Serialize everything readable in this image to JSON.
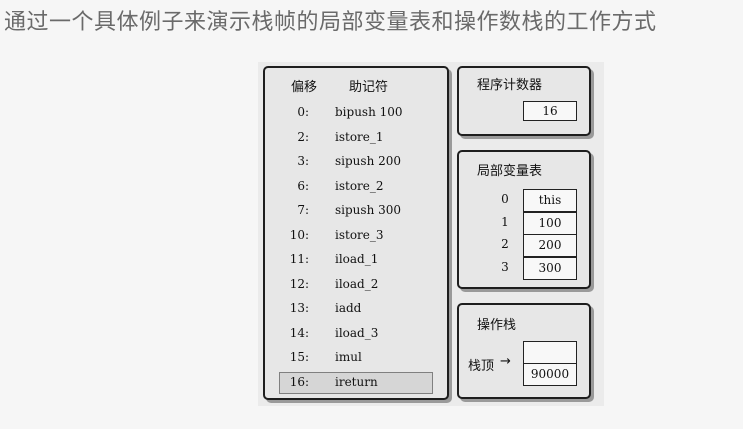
{
  "heading": "通过一个具体例子来演示栈帧的局部变量表和操作数栈的工作方式",
  "code_table": {
    "header_offset": "偏移",
    "header_mnemonic": "助记符",
    "rows": [
      {
        "offset": "0:",
        "instruction": "bipush  100"
      },
      {
        "offset": "2:",
        "instruction": "istore_1"
      },
      {
        "offset": "3:",
        "instruction": "sipush  200"
      },
      {
        "offset": "6:",
        "instruction": "istore_2"
      },
      {
        "offset": "7:",
        "instruction": "sipush  300"
      },
      {
        "offset": "10:",
        "instruction": "istore_3"
      },
      {
        "offset": "11:",
        "instruction": "iload_1"
      },
      {
        "offset": "12:",
        "instruction": "iload_2"
      },
      {
        "offset": "13:",
        "instruction": "iadd"
      },
      {
        "offset": "14:",
        "instruction": "iload_3"
      },
      {
        "offset": "15:",
        "instruction": "imul"
      },
      {
        "offset": "16:",
        "instruction": "ireturn"
      }
    ],
    "highlighted_row": 11
  },
  "program_counter": {
    "title": "程序计数器",
    "value": "16"
  },
  "local_variables": {
    "title": "局部变量表",
    "slots": [
      {
        "index": "0",
        "value": "this"
      },
      {
        "index": "1",
        "value": "100"
      },
      {
        "index": "2",
        "value": "200"
      },
      {
        "index": "3",
        "value": "300"
      }
    ]
  },
  "operand_stack": {
    "title": "操作栈",
    "top_label": "栈顶",
    "arrow": "→",
    "slots": [
      "",
      "90000"
    ]
  }
}
